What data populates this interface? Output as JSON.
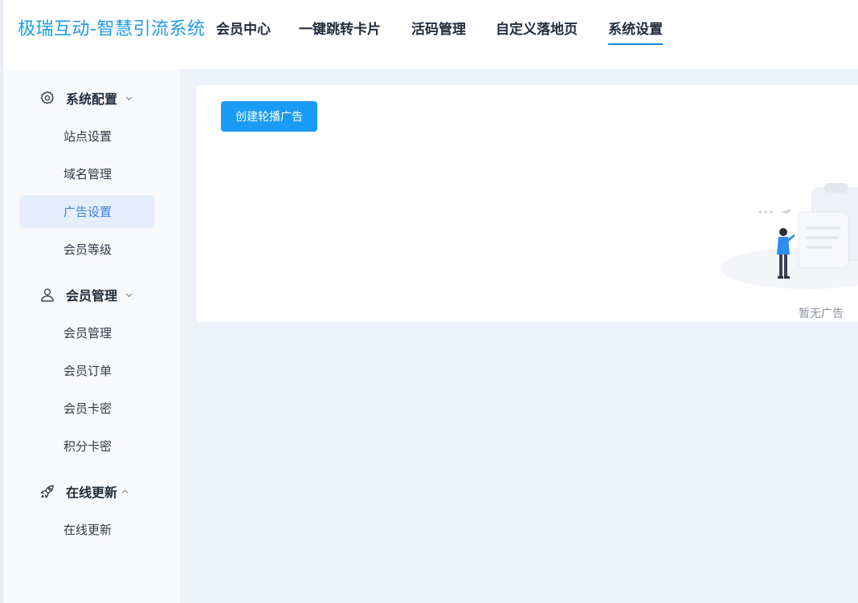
{
  "header": {
    "logo": "极瑞互动-智慧引流系统",
    "nav": [
      "会员中心",
      "一键跳转卡片",
      "活码管理",
      "自定义落地页",
      "系统设置"
    ],
    "active_nav": "系统设置"
  },
  "sidebar": {
    "groups": [
      {
        "title": "系统配置",
        "icon": "gear-icon",
        "expanded": true,
        "items": [
          "站点设置",
          "域名管理",
          "广告设置",
          "会员等级"
        ]
      },
      {
        "title": "会员管理",
        "icon": "user-icon",
        "expanded": true,
        "items": [
          "会员管理",
          "会员订单",
          "会员卡密",
          "积分卡密"
        ]
      },
      {
        "title": "在线更新",
        "icon": "rocket-icon",
        "expanded": true,
        "items": [
          "在线更新"
        ]
      }
    ],
    "active_item": "广告设置"
  },
  "main": {
    "create_button": "创建轮播广告",
    "empty_text": "暂无广告"
  },
  "colors": {
    "accent": "#1a9bf5",
    "logo": "#1e9be6",
    "active_bg": "#e5eefc",
    "active_text": "#3b82e0",
    "page_bg": "#eef2fb"
  }
}
